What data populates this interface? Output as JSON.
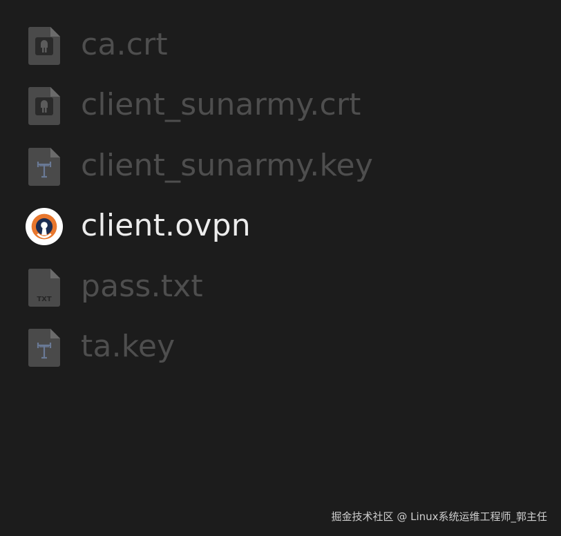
{
  "files": [
    {
      "name": "ca.crt",
      "icon": "certificate-icon",
      "selected": false
    },
    {
      "name": "client_sunarmy.crt",
      "icon": "certificate-icon",
      "selected": false
    },
    {
      "name": "client_sunarmy.key",
      "icon": "key-file-icon",
      "selected": false
    },
    {
      "name": "client.ovpn",
      "icon": "openvpn-icon",
      "selected": true
    },
    {
      "name": "pass.txt",
      "icon": "text-file-icon",
      "selected": false,
      "icon_label": "TXT"
    },
    {
      "name": "ta.key",
      "icon": "key-file-icon",
      "selected": false
    }
  ],
  "watermark": "掘金技术社区 @ Linux系统运维工程师_郭主任",
  "colors": {
    "background": "#1c1c1c",
    "dimmed_text": "#4e4e4e",
    "selected_text": "#ececec",
    "openvpn_orange": "#e8772e",
    "openvpn_navy": "#1c2d52"
  }
}
